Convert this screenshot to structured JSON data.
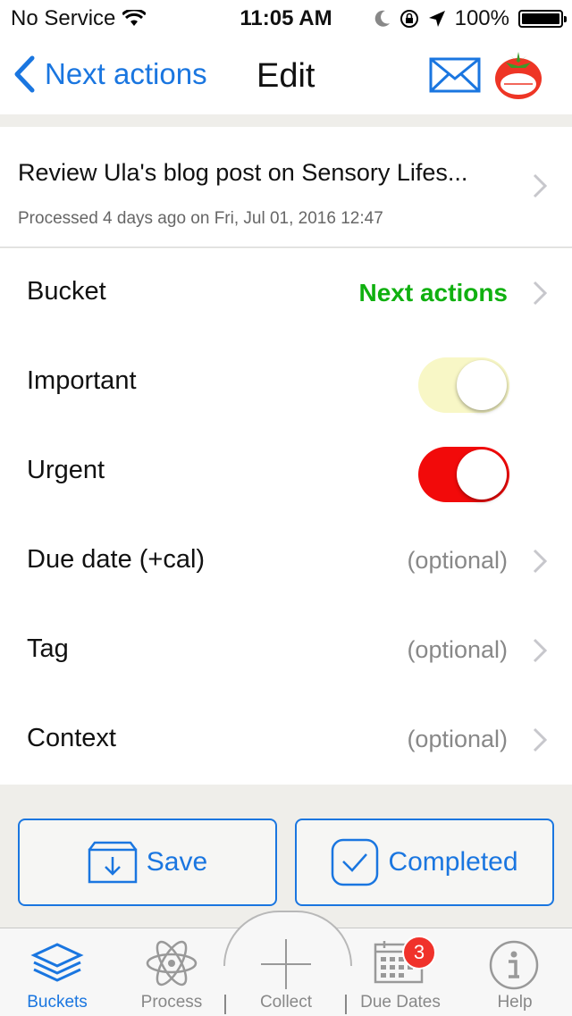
{
  "status": {
    "carrier": "No Service",
    "time": "11:05 AM",
    "battery": "100%"
  },
  "nav": {
    "back_label": "Next actions",
    "title": "Edit"
  },
  "task": {
    "title": "Review Ula's blog post on Sensory Lifes...",
    "subtitle": "Processed 4 days ago on Fri, Jul 01, 2016 12:47"
  },
  "rows": {
    "bucket": {
      "label": "Bucket",
      "value": "Next actions"
    },
    "important": {
      "label": "Important",
      "on": true,
      "color": "#f8f7c6"
    },
    "urgent": {
      "label": "Urgent",
      "on": true,
      "color": "#f20a0a"
    },
    "due_date": {
      "label": "Due date (+cal)",
      "value": "(optional)"
    },
    "tag": {
      "label": "Tag",
      "value": "(optional)"
    },
    "context": {
      "label": "Context",
      "value": "(optional)"
    }
  },
  "actions": {
    "save_label": "Save",
    "completed_label": "Completed"
  },
  "tabs": {
    "buckets": "Buckets",
    "process": "Process",
    "collect": "Collect",
    "due_dates": "Due Dates",
    "due_dates_badge": "3",
    "help": "Help"
  },
  "colors": {
    "accent": "#1a76e0",
    "green": "#10b010",
    "badge": "#f0322b"
  }
}
